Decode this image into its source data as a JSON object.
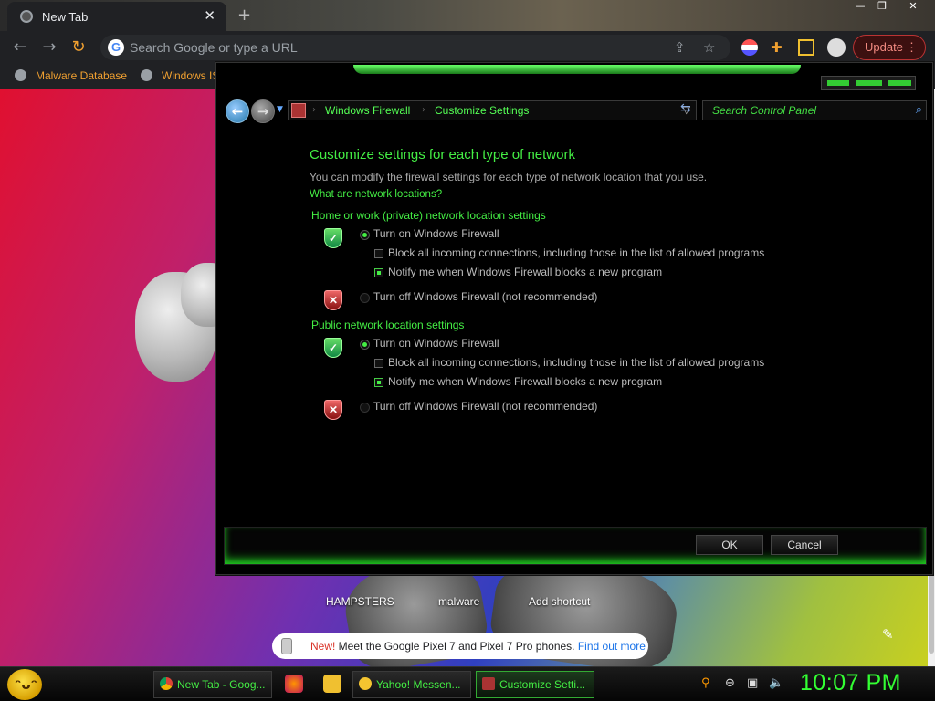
{
  "browser": {
    "tab_title": "New Tab",
    "tab_close": "✕",
    "new_tab": "+",
    "omnibox_placeholder": "Search Google or type a URL",
    "update_label": "Update",
    "update_menu": "⋮",
    "bookmarks": [
      "Malware Database",
      "Windows IS"
    ]
  },
  "ntp": {
    "shortcuts": [
      "HAMPSTERS",
      "malware",
      "Add shortcut"
    ],
    "promo_new": "New!",
    "promo_text": " Meet the Google Pixel 7 and Pixel 7 Pro phones. ",
    "promo_link": "Find out more"
  },
  "control_panel": {
    "breadcrumbs": [
      "Windows Firewall",
      "Customize Settings"
    ],
    "search_placeholder": "Search Control Panel",
    "title": "Customize settings for each type of network",
    "description": "You can modify the firewall settings for each type of network location that you use.",
    "help_link": "What are network locations?",
    "sections": [
      {
        "heading": "Home or work (private) network location settings",
        "turn_on_label": "Turn on Windows Firewall",
        "turn_on_selected": true,
        "block_all_label": "Block all incoming connections, including those in the list of allowed programs",
        "block_all_checked": false,
        "notify_label": "Notify me when Windows Firewall blocks a new program",
        "notify_checked": true,
        "turn_off_label": "Turn off Windows Firewall (not recommended)",
        "turn_off_selected": false
      },
      {
        "heading": "Public network location settings",
        "turn_on_label": "Turn on Windows Firewall",
        "turn_on_selected": true,
        "block_all_label": "Block all incoming connections, including those in the list of allowed programs",
        "block_all_checked": false,
        "notify_label": "Notify me when Windows Firewall blocks a new program",
        "notify_checked": true,
        "turn_off_label": "Turn off Windows Firewall (not recommended)",
        "turn_off_selected": false
      }
    ],
    "ok_label": "OK",
    "cancel_label": "Cancel"
  },
  "taskbar": {
    "tasks": [
      "New Tab - Goog...",
      "Yahoo! Messen...",
      "Customize Setti..."
    ],
    "clock": "10:07 PM"
  },
  "colors": {
    "accent_green": "#44ee44",
    "update_red": "#f28b82"
  }
}
